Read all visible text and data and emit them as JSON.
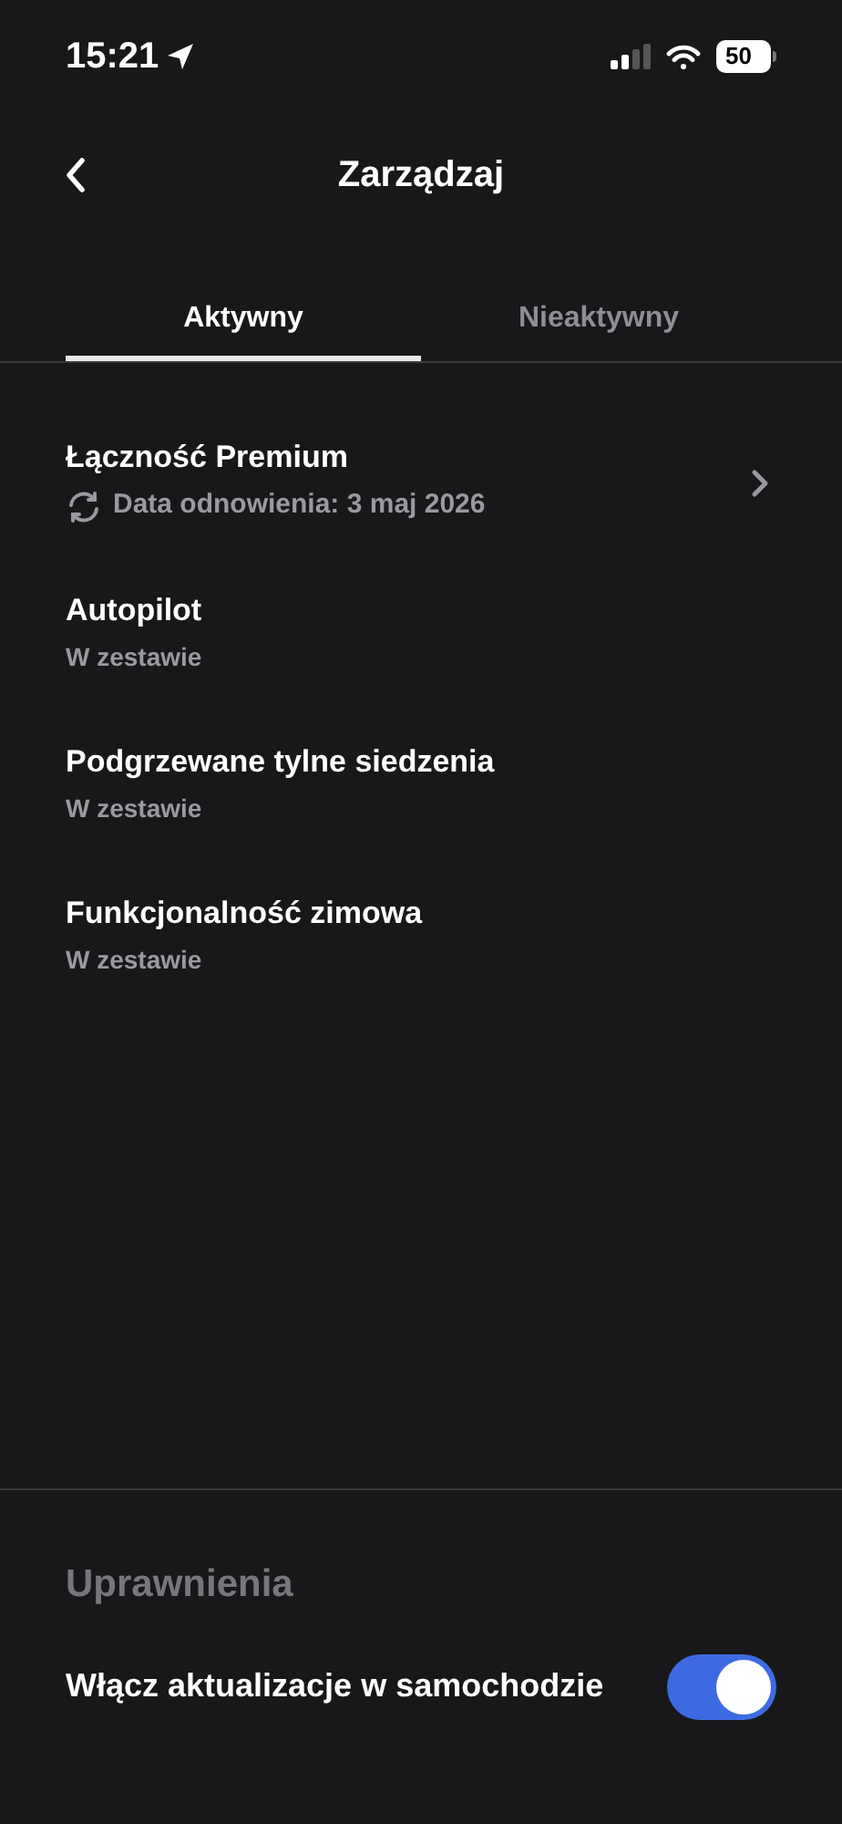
{
  "status_bar": {
    "time": "15:21",
    "battery": "50"
  },
  "header": {
    "title": "Zarządzaj"
  },
  "tabs": [
    {
      "label": "Aktywny",
      "selected": true
    },
    {
      "label": "Nieaktywny",
      "selected": false
    }
  ],
  "features": [
    {
      "kind": "renewal",
      "title": "Łączność Premium",
      "subtitle": "Data odnowienia: 3 maj 2026"
    },
    {
      "kind": "included",
      "title": "Autopilot",
      "subtitle": "W zestawie"
    },
    {
      "kind": "included",
      "title": "Podgrzewane tylne siedzenia",
      "subtitle": "W zestawie"
    },
    {
      "kind": "included",
      "title": "Funkcjonalność zimowa",
      "subtitle": "W zestawie"
    }
  ],
  "permissions": {
    "heading": "Uprawnienia",
    "settings": [
      {
        "label": "Włącz aktualizacje w samochodzie",
        "on": true
      }
    ]
  }
}
